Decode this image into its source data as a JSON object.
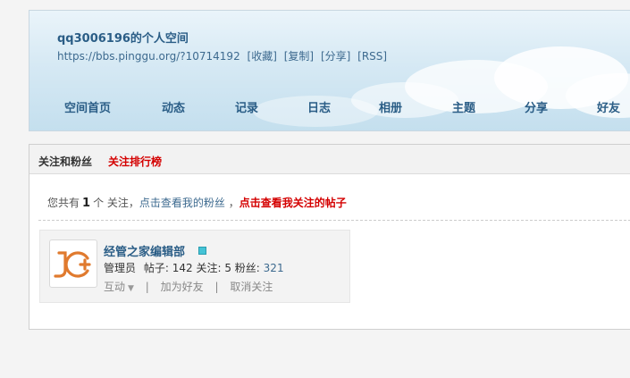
{
  "header": {
    "title": "qq3006196的个人空间",
    "url": "https://bbs.pinggu.org/?10714192",
    "links": [
      "[收藏]",
      "[复制]",
      "[分享]",
      "[RSS]"
    ],
    "nav": [
      "空间首页",
      "动态",
      "记录",
      "日志",
      "相册",
      "主题",
      "分享",
      "好友"
    ]
  },
  "tabs": {
    "follow_fans": "关注和粉丝",
    "ranking": "关注排行榜"
  },
  "summary": {
    "prefix": "您共有",
    "count": "1",
    "suffix": "个 关注，",
    "view_fans": "点击查看我的粉丝",
    "comma": "，",
    "view_posts": "点击查看我关注的帖子"
  },
  "user": {
    "name": "经管之家编辑部",
    "role": "管理员",
    "posts_label": "帖子:",
    "posts": "142",
    "following_label": "关注:",
    "following": "5",
    "fans_label": "粉丝:",
    "fans": "321",
    "avatar_text": "JG"
  },
  "actions": {
    "interact": "互动",
    "add_friend": "加为好友",
    "unfollow": "取消关注"
  },
  "colors": {
    "accent": "#2a5d86",
    "red": "#d40000",
    "logo": "#e07a2e"
  }
}
